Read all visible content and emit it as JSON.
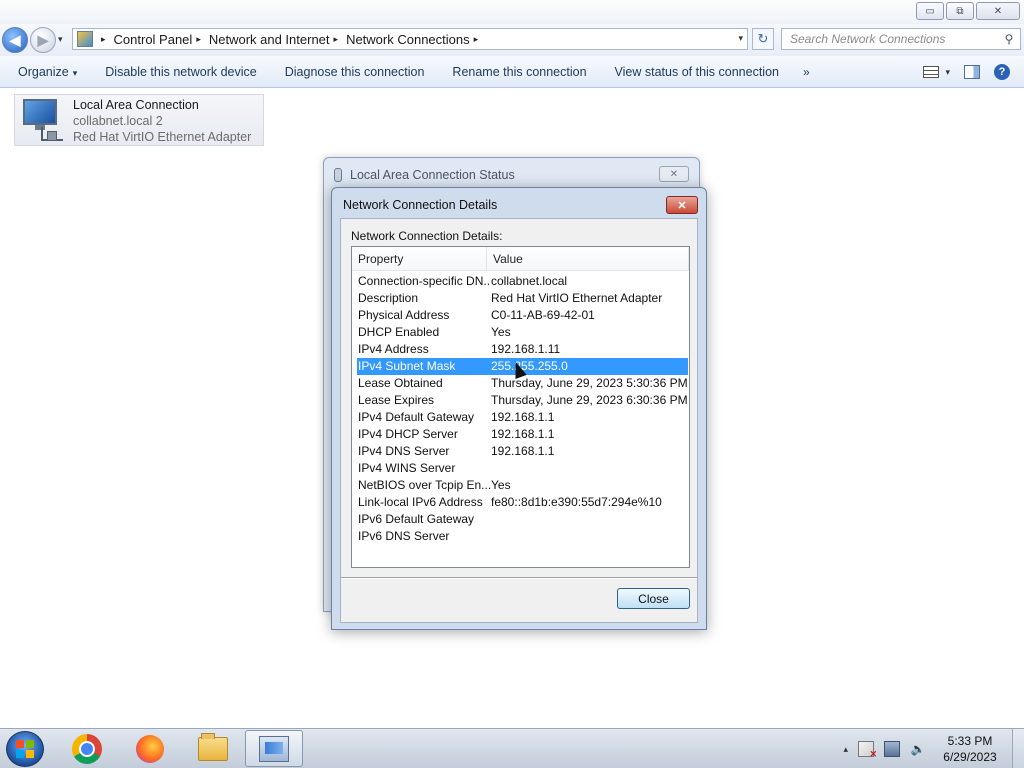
{
  "window": {
    "minimize_glyph": "▭",
    "maximize_glyph": "⧉",
    "close_glyph": "✕"
  },
  "nav": {
    "back_glyph": "◀",
    "forward_glyph": "▶",
    "dropdown_glyph": "▾"
  },
  "address": {
    "separator": "▸",
    "crumbs": [
      "Control Panel",
      "Network and Internet",
      "Network Connections"
    ],
    "dropdown_glyph": "▾",
    "refresh_glyph": "↻"
  },
  "search": {
    "placeholder": "Search Network Connections",
    "icon": "search-icon",
    "glyph": "⚲"
  },
  "commands": {
    "organize": "Organize",
    "disable": "Disable this network device",
    "diagnose": "Diagnose this connection",
    "rename": "Rename this connection",
    "view_status": "View status of this connection",
    "more": "»",
    "dropdown_glyph": "▾",
    "help_glyph": "?"
  },
  "connection": {
    "name": "Local Area Connection",
    "network": "collabnet.local  2",
    "adapter": "Red Hat VirtIO Ethernet Adapter"
  },
  "status_dialog": {
    "title": "Local Area Connection Status",
    "close_glyph": "✕"
  },
  "details_dialog": {
    "title": "Network Connection Details",
    "close_glyph": "✕",
    "label": "Network Connection Details:",
    "columns": {
      "property": "Property",
      "value": "Value"
    },
    "rows": [
      {
        "property": "Connection-specific DN...",
        "value": "collabnet.local"
      },
      {
        "property": "Description",
        "value": "Red Hat VirtIO Ethernet Adapter"
      },
      {
        "property": "Physical Address",
        "value": "C0-11-AB-69-42-01"
      },
      {
        "property": "DHCP Enabled",
        "value": "Yes"
      },
      {
        "property": "IPv4 Address",
        "value": "192.168.1.11"
      },
      {
        "property": "IPv4 Subnet Mask",
        "value": "255.255.255.0"
      },
      {
        "property": "Lease Obtained",
        "value": "Thursday, June 29, 2023 5:30:36 PM"
      },
      {
        "property": "Lease Expires",
        "value": "Thursday, June 29, 2023 6:30:36 PM"
      },
      {
        "property": "IPv4 Default Gateway",
        "value": "192.168.1.1"
      },
      {
        "property": "IPv4 DHCP Server",
        "value": "192.168.1.1"
      },
      {
        "property": "IPv4 DNS Server",
        "value": "192.168.1.1"
      },
      {
        "property": "IPv4 WINS Server",
        "value": ""
      },
      {
        "property": "NetBIOS over Tcpip En...",
        "value": "Yes"
      },
      {
        "property": "Link-local IPv6 Address",
        "value": "fe80::8d1b:e390:55d7:294e%10"
      },
      {
        "property": "IPv6 Default Gateway",
        "value": ""
      },
      {
        "property": "IPv6 DNS Server",
        "value": ""
      }
    ],
    "selected_row": "IPv4 Subnet Mask",
    "close_button": "Close"
  },
  "taskbar": {
    "apps": [
      "chrome-icon",
      "firefox-icon",
      "folder-icon",
      "control-panel-icon"
    ],
    "active_app": "control-panel-icon",
    "tray_arrow": "▴",
    "volume_glyph": "🔈",
    "time": "5:33 PM",
    "date": "6/29/2023"
  },
  "colors": {
    "selection": "#3399ff",
    "command_text": "#1e395b",
    "dialog_frame": "#cfdced"
  }
}
